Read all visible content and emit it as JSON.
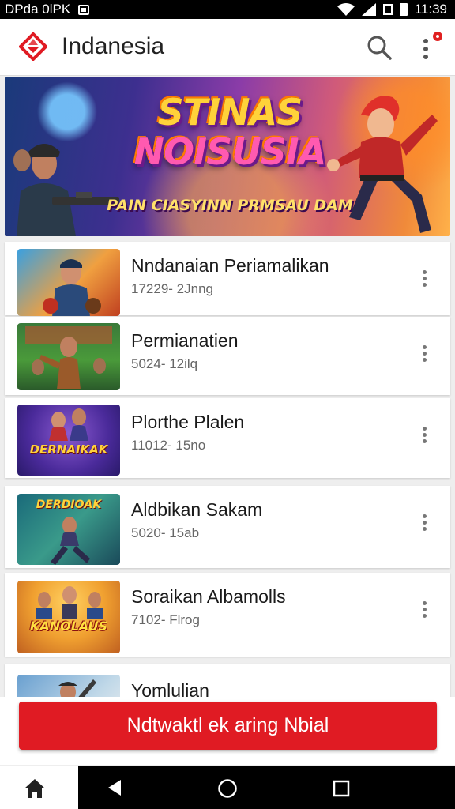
{
  "status_bar": {
    "left_text": "DPda 0lPK",
    "time": "11:39"
  },
  "app_bar": {
    "title": "Indanesia",
    "logo_icon": "diamond-logo-icon",
    "accent_color": "#e01b23"
  },
  "banner": {
    "title_line1": "STINAS",
    "title_line2": "NOISUSIA",
    "subtitle": "PAIN CIASYINN PRMSAU DAM"
  },
  "items": [
    {
      "title": "Nndanaian Periamalikan",
      "subtitle": "17229- 2Jnng",
      "thumb_label": ""
    },
    {
      "title": "Permianatien",
      "subtitle": "5024- 12ilq",
      "thumb_label": ""
    },
    {
      "title": "Plorthe Plalen",
      "subtitle": "11012- 15no",
      "thumb_label": "DERNAIKAK"
    },
    {
      "title": "Aldbikan Sakam",
      "subtitle": "5020- 15ab",
      "thumb_label": "DERDIOAK"
    },
    {
      "title": "Soraikan Albamolls",
      "subtitle": "7102- Flrog",
      "thumb_label": "KANOLAUS"
    },
    {
      "title": "Yomlulian",
      "subtitle": "",
      "thumb_label": ""
    }
  ],
  "cta": {
    "label": "Ndtwaktl ek aring Nbial"
  },
  "nav": {
    "home_icon": "home-icon",
    "back_icon": "back-triangle-icon",
    "home_circle_icon": "home-circle-icon",
    "recents_icon": "recents-square-icon"
  }
}
